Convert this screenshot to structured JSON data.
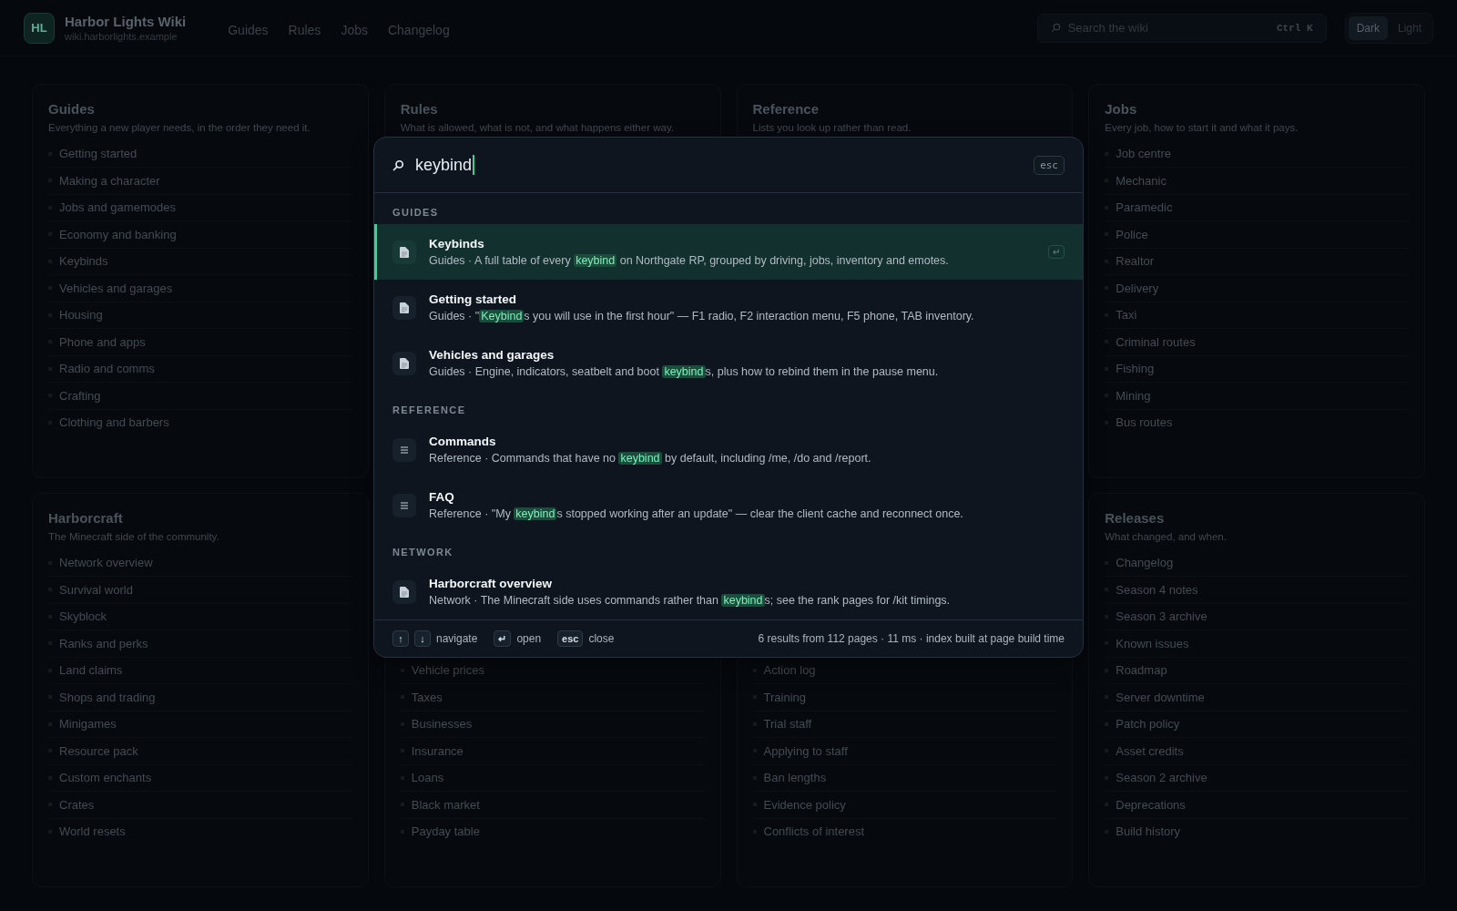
{
  "header": {
    "logo": "HL",
    "title": "Harbor Lights Wiki",
    "subtitle": "wiki.harborlights.example",
    "nav": [
      "Guides",
      "Rules",
      "Jobs",
      "Changelog"
    ],
    "search": {
      "placeholder": "Search the wiki",
      "shortcut": "Ctrl K"
    },
    "theme": [
      {
        "label": "Dark",
        "selected": true
      },
      {
        "label": "Light",
        "selected": false
      }
    ]
  },
  "sections": [
    {
      "title": "Guides",
      "subtitle": "Everything a new player needs, in the order they need it.",
      "items": [
        "Getting started",
        "Making a character",
        "Jobs and gamemodes",
        "Economy and banking",
        "Keybinds",
        "Vehicles and garages",
        "Housing",
        "Phone and apps",
        "Radio and comms",
        "Crafting",
        "Clothing and barbers"
      ]
    },
    {
      "title": "Rules",
      "subtitle": "What is allowed, what is not, and what happens either way."
    },
    {
      "title": "Reference",
      "subtitle": "Lists you look up rather than read."
    },
    {
      "title": "Jobs",
      "subtitle": "Every job, how to start it and what it pays.",
      "items": [
        "Job centre",
        "Mechanic",
        "Paramedic",
        "Police",
        "Realtor",
        "Delivery",
        "Taxi",
        "Criminal routes",
        "Fishing",
        "Mining",
        "Bus routes"
      ]
    },
    {
      "title": "Harborcraft",
      "subtitle": "The Minecraft side of the community.",
      "items": [
        "Network overview",
        "Survival world",
        "Skyblock",
        "Ranks and perks",
        "Land claims",
        "Shops and trading",
        "Minigames",
        "Resource pack",
        "Custom enchants",
        "Crates",
        "World resets"
      ]
    },
    {
      "items": [
        "Vehicle prices",
        "Taxes",
        "Businesses",
        "Insurance",
        "Loans",
        "Black market",
        "Payday table"
      ]
    },
    {
      "items": [
        "Action log",
        "Training",
        "Trial staff",
        "Applying to staff",
        "Ban lengths",
        "Evidence policy",
        "Conflicts of interest"
      ]
    },
    {
      "title": "Releases",
      "subtitle": "What changed, and when.",
      "items": [
        "Changelog",
        "Season 4 notes",
        "Season 3 archive",
        "Known issues",
        "Roadmap",
        "Server downtime",
        "Patch policy",
        "Asset credits",
        "Season 2 archive",
        "Deprecations",
        "Build history"
      ]
    }
  ],
  "palette": {
    "query": "keybind",
    "close": "esc",
    "groups": [
      {
        "label": "GUIDES",
        "results": [
          {
            "kind": "page",
            "title": "Keybinds",
            "before": "Guides · A full table of every ",
            "match": "keybind",
            "after": " on Northgate RP, grouped by driving, jobs, inventory and emotes.",
            "selected": true,
            "hint": "↵"
          },
          {
            "kind": "page",
            "title": "Getting started",
            "before": "Guides · \"",
            "match": "Keybind",
            "after": "s you will use in the first hour\" — F1 radio, F2 interaction menu, F5 phone, TAB inventory.",
            "selected": false
          },
          {
            "kind": "page",
            "title": "Vehicles and garages",
            "before": "Guides · Engine, indicators, seatbelt and boot ",
            "match": "keybind",
            "after": "s, plus how to rebind them in the pause menu.",
            "selected": false
          }
        ]
      },
      {
        "label": "REFERENCE",
        "results": [
          {
            "kind": "list",
            "title": "Commands",
            "before": "Reference · Commands that have no ",
            "match": "keybind",
            "after": " by default, including /me, /do and /report.",
            "selected": false
          },
          {
            "kind": "list",
            "title": "FAQ",
            "before": "Reference · \"My ",
            "match": "keybind",
            "after": "s stopped working after an update\" — clear the client cache and reconnect once.",
            "selected": false
          }
        ]
      },
      {
        "label": "NETWORK",
        "results": [
          {
            "kind": "page",
            "title": "Harborcraft overview",
            "before": "Network · The Minecraft side uses commands rather than ",
            "match": "keybind",
            "after": "s; see the rank pages for /kit timings.",
            "selected": false
          }
        ]
      }
    ],
    "footer": {
      "keys": [
        {
          "keys": [
            "↑",
            "↓"
          ],
          "label": "navigate"
        },
        {
          "keys": [
            "↵"
          ],
          "label": "open"
        },
        {
          "keys": [
            "esc"
          ],
          "label": "close"
        }
      ],
      "stats": "6 results from 112 pages · 11 ms · index built at page build time"
    }
  }
}
